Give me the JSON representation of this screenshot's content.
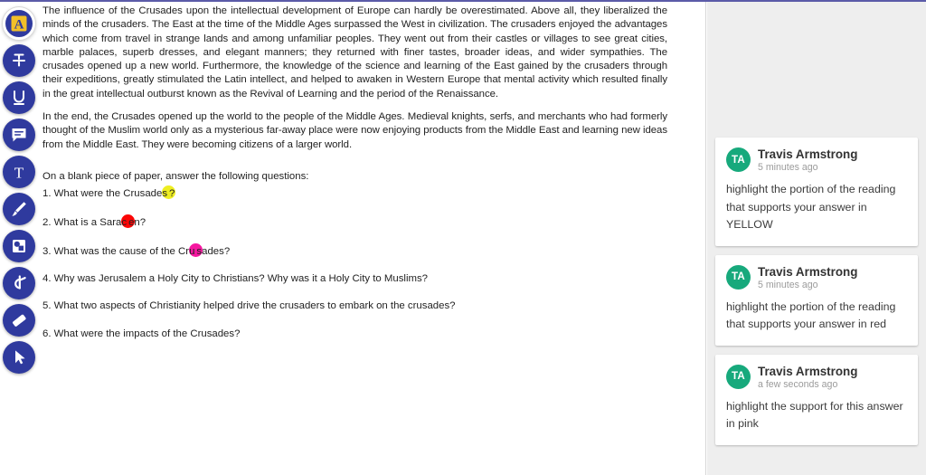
{
  "toolbar": {
    "tools": [
      {
        "id": "highlighter",
        "icon": "highlighter-a-icon",
        "label": "Highlight",
        "active": true
      },
      {
        "id": "strikethrough",
        "icon": "strikethrough-icon",
        "label": "Strikethrough",
        "active": false
      },
      {
        "id": "underline",
        "icon": "underline-icon",
        "label": "Underline",
        "active": false
      },
      {
        "id": "comment",
        "icon": "comment-icon",
        "label": "Comment",
        "active": false
      },
      {
        "id": "text",
        "icon": "text-tool-icon",
        "label": "Text",
        "active": false
      },
      {
        "id": "brush",
        "icon": "paintbrush-icon",
        "label": "Draw",
        "active": false
      },
      {
        "id": "shape",
        "icon": "shapes-icon",
        "label": "Shapes",
        "active": false
      },
      {
        "id": "signature",
        "icon": "signature-icon",
        "label": "Signature",
        "active": false
      },
      {
        "id": "eraser",
        "icon": "eraser-icon",
        "label": "Eraser",
        "active": false
      },
      {
        "id": "select",
        "icon": "cursor-arrow-icon",
        "label": "Select",
        "active": false
      }
    ]
  },
  "document": {
    "paragraphs": [
      "The influence of the Crusades upon the intellectual development of Europe can hardly be overestimated. Above all, they liberalized the minds of the crusaders. The East at the time of the Middle Ages surpassed the West in civilization. The crusaders enjoyed the advantages which come from travel in strange lands and among unfamiliar peoples. They went out from their castles or villages to see great cities, marble palaces, superb dresses, and elegant manners; they returned with finer tastes, broader ideas, and wider sympathies. The crusades opened up a new world. Furthermore, the knowledge of the science and learning of the East gained by the crusaders through their expeditions, greatly stimulated the Latin intellect, and helped to awaken in Western Europe that mental activity which resulted finally in the great intellectual outburst known as the Revival of Learning and the period of the Renaissance.",
      "In the end, the Crusades opened up the world to the people of the Middle Ages. Medieval knights, serfs, and merchants who had formerly thought of the Muslim world only as a mysterious far-away place were now enjoying products from the Middle East and learning new ideas from the Middle East. They were becoming citizens of a larger world."
    ],
    "instruction": "On a blank piece of paper, answer the following questions:",
    "questions": [
      {
        "before": "1.  What were the Crusades",
        "highlight": "yellow",
        "after": "?"
      },
      {
        "before": "2.  What is a Sarac",
        "highlight": "red",
        "after": "en?"
      },
      {
        "before": "3. What was the cause of the Cru",
        "highlight": "pink",
        "after": "sades?"
      },
      {
        "before": "4. Why was Jerusalem a Holy City to Christians?  Why was it a Holy City to Muslims?",
        "highlight": "none",
        "after": ""
      },
      {
        "before": "5. What two aspects of Christianity helped drive the crusaders to embark on the crusades?",
        "highlight": "none",
        "after": ""
      },
      {
        "before": "6. What were the impacts of the Crusades?",
        "highlight": "none",
        "after": ""
      }
    ]
  },
  "colors": {
    "highlight_yellow": "#eeee22",
    "highlight_red": "#fb0606",
    "highlight_pink": "#f5179f",
    "toolbar_blue": "#2f3a9e",
    "avatar_green": "#17a97c",
    "top_rule": "#5b5ba8"
  },
  "comments": [
    {
      "initials": "TA",
      "author": "Travis Armstrong",
      "time": "5 minutes ago",
      "text": "highlight the portion of the reading that supports your answer in YELLOW"
    },
    {
      "initials": "TA",
      "author": "Travis Armstrong",
      "time": "5 minutes ago",
      "text": "highlight the portion of the reading that supports your answer in red"
    },
    {
      "initials": "TA",
      "author": "Travis Armstrong",
      "time": "a few seconds ago",
      "text": "highlight the support for this answer in pink"
    }
  ]
}
